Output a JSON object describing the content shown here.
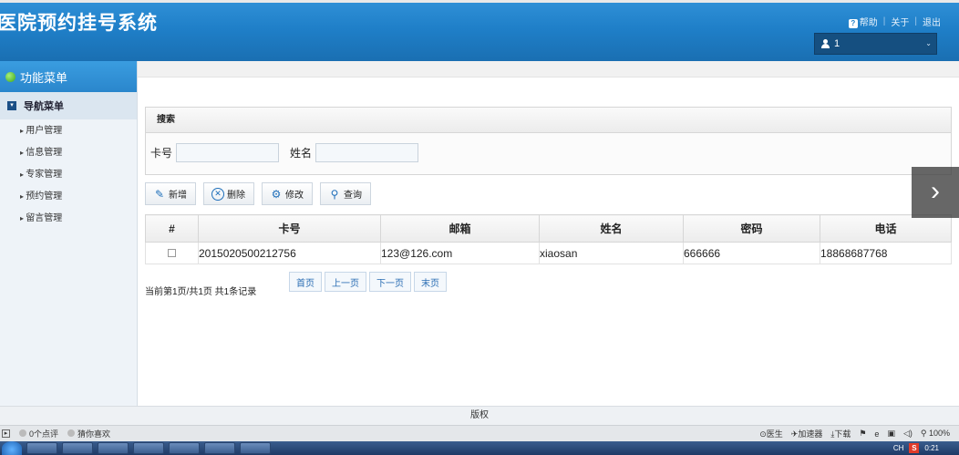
{
  "app": {
    "title": "医院预约挂号系统"
  },
  "header": {
    "help_label": "帮助",
    "about_label": "关于",
    "logout_label": "退出",
    "user_value": "1"
  },
  "sidebar": {
    "func_menu_label": "功能菜单",
    "nav_header": "导航菜单",
    "items": [
      {
        "label": "用户管理"
      },
      {
        "label": "信息管理"
      },
      {
        "label": "专家管理"
      },
      {
        "label": "预约管理"
      },
      {
        "label": "留言管理"
      }
    ]
  },
  "search": {
    "title": "搜索",
    "card_label": "卡号",
    "card_value": "",
    "name_label": "姓名",
    "name_value": ""
  },
  "toolbar": {
    "add": "新增",
    "delete": "删除",
    "edit": "修改",
    "query": "查询"
  },
  "table": {
    "headers": [
      "#",
      "卡号",
      "邮箱",
      "姓名",
      "密码",
      "电话"
    ],
    "rows": [
      {
        "card": "2015020500212756",
        "email": "123@126.com",
        "name": "xiaosan",
        "password": "666666",
        "phone": "18868687768"
      }
    ]
  },
  "pager": {
    "info": "当前第1页/共1页 共1条记录",
    "first": "首页",
    "prev": "上一页",
    "next": "下一页",
    "last": "末页"
  },
  "footer": {
    "copyright": "版权"
  },
  "browser_status": {
    "comments": "0个点评",
    "guess_like": "猜你喜欢",
    "doctor": "医生",
    "accelerator": "加速器",
    "download": "下载",
    "zoom": "100%"
  },
  "taskbar": {
    "lang": "CH",
    "clock": "0:21"
  },
  "colors": {
    "header_blue": "#1f7fc8",
    "sidebar_bg": "#eef3f8",
    "link_blue": "#2a6db3"
  }
}
